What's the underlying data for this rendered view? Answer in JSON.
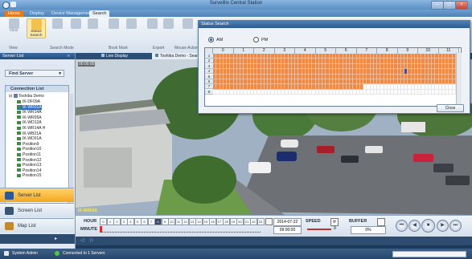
{
  "window": {
    "title": "Surveillix Central Station"
  },
  "ribbon_tabs": [
    "Home",
    "Display",
    "Device Management",
    "Search"
  ],
  "ribbon": {
    "buttons": [
      {
        "label": "View",
        "icon": "view-icon"
      },
      {
        "label": "Status Search",
        "icon": "status-search-icon"
      },
      {
        "label": "",
        "icon": "search-a-icon"
      },
      {
        "label": "",
        "icon": "search-b-icon"
      },
      {
        "label": "",
        "icon": "search-c-icon"
      },
      {
        "label": "",
        "icon": "bookmark-a-icon"
      },
      {
        "label": "",
        "icon": "bookmark-b-icon"
      },
      {
        "label": "",
        "icon": "export-icon"
      },
      {
        "label": "",
        "icon": "export-b-icon"
      },
      {
        "label": "",
        "icon": "mouse-action-icon"
      }
    ],
    "groups": [
      "View",
      "Search Mode",
      "Book Mark",
      "Export",
      "Mouse Action"
    ]
  },
  "left_panel": {
    "title": "Server List",
    "find_server": "Find Server",
    "connection_list_title": "Connection List",
    "server_name": "Toshiba Demo",
    "cameras": [
      "IK-DF09A",
      "IK-WR01A",
      "IK-WR14A",
      "IK-WR05A",
      "IK-WD12A",
      "IK-WR14A H",
      "IK-WB21A",
      "IK-WD01A",
      "Position9",
      "Position10",
      "Position11",
      "Position12",
      "Position13",
      "Position14",
      "Position15"
    ],
    "selected_index": 1,
    "nav": [
      "Server List",
      "Screen List",
      "Map List"
    ]
  },
  "video": {
    "tabs": [
      "Live Display",
      "Toshiba Demo - Sear"
    ],
    "overlay_top": "00:00:00",
    "camera_label": "IK-WR05A"
  },
  "controls": {
    "hour_label": "HOUR",
    "minute_label": "MINUTE",
    "hours": [
      "0",
      "1",
      "2",
      "3",
      "4",
      "5",
      "6",
      "7",
      "8",
      "9",
      "10",
      "11",
      "12",
      "13",
      "14",
      "15",
      "16",
      "17",
      "18",
      "19",
      "20",
      "21",
      "22",
      "23"
    ],
    "current_hour": "8",
    "date": "2014-07-22",
    "time": "09:00:00",
    "speed_label": "SPEED",
    "speed_value": "0",
    "buffer_label": "BUFFER",
    "buffer_value": "0%"
  },
  "status_bar": {
    "user": "System Admin",
    "connection": "Connected to 1 Servers"
  },
  "dialog": {
    "title": "Status Search",
    "am": "AM",
    "pm": "PM",
    "selected": "AM",
    "hours": [
      "0",
      "1",
      "2",
      "3",
      "4",
      "5",
      "6",
      "7",
      "8",
      "9",
      "10",
      "11"
    ],
    "row_labels": [
      "1",
      "2",
      "3",
      "4",
      "5",
      "6",
      "7",
      "8"
    ],
    "close_label": "Close"
  }
}
